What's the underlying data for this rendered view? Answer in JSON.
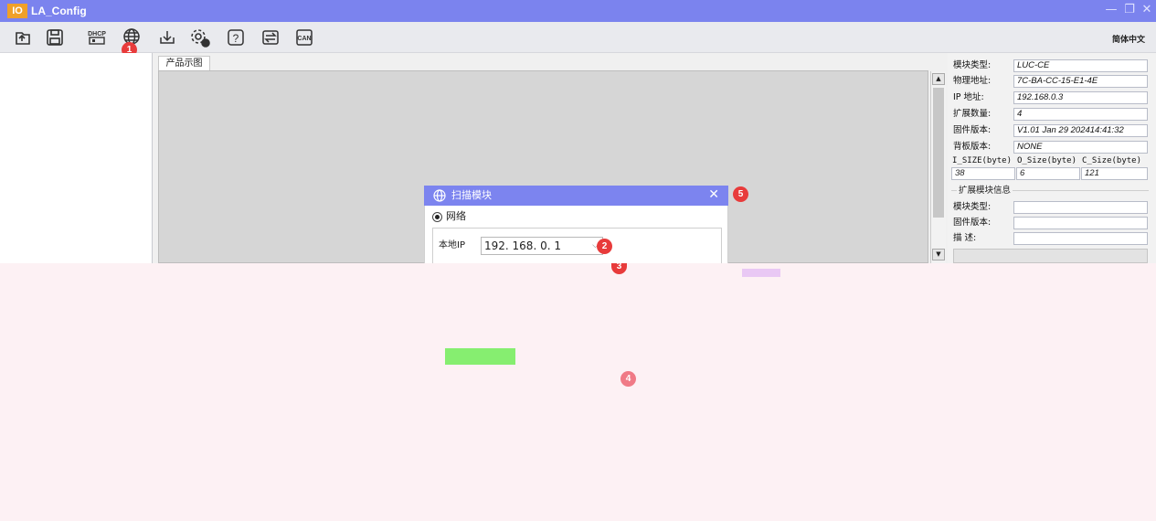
{
  "app": {
    "logo_text": "IO",
    "title": "LA_Config",
    "window_controls": {
      "minimize": "—",
      "restore": "❐",
      "close": "✕"
    }
  },
  "toolbar": {
    "language": "简体中文",
    "dhcp_label": "DHCP",
    "can_label": "CAN",
    "help_label": "?",
    "buttons": [
      {
        "icon": "open-file-icon"
      },
      {
        "icon": "save-icon"
      },
      {
        "icon": "dhcp-icon"
      },
      {
        "icon": "globe-scan-icon"
      },
      {
        "icon": "download-icon"
      },
      {
        "icon": "gear-settings-icon"
      },
      {
        "icon": "help-icon"
      },
      {
        "icon": "compare-icon"
      },
      {
        "icon": "can-icon"
      }
    ]
  },
  "annotations": {
    "b1": "1",
    "b2": "2",
    "b3": "3",
    "b4": "4",
    "b5": "5"
  },
  "center": {
    "tab_label": "产品示图"
  },
  "dialog": {
    "title": "扫描模块",
    "radio_label": "网络",
    "ip_label": "本地IP",
    "ip_value": "192. 168. 0. 1"
  },
  "module_info": {
    "fields": [
      {
        "label": "模块类型:",
        "value": "LUC-CE"
      },
      {
        "label": "物理地址:",
        "value": "7C-BA-CC-15-E1-4E"
      },
      {
        "label": " IP 地址:",
        "value": "192.168.0.3"
      },
      {
        "label": "扩展数量:",
        "value": "4"
      },
      {
        "label": "固件版本:",
        "value": "V1.01 Jan 29 202414:41:32"
      },
      {
        "label": "背板版本:",
        "value": "NONE"
      }
    ],
    "size_headers": [
      "I_SIZE(byte)",
      "O_Size(byte)",
      "C_Size(byte)"
    ],
    "size_values": [
      "38",
      "6",
      "121"
    ],
    "ext_title": "扩展模块信息",
    "ext_fields": [
      {
        "label": "模块类型:"
      },
      {
        "label": "固件版本:"
      },
      {
        "label": "描    述:"
      }
    ]
  },
  "colors": {
    "titlebar": "#7b83ee",
    "dialog_header": "#7c84ef",
    "badge": "#e83b3b",
    "lower_region": "#fdf1f4"
  }
}
